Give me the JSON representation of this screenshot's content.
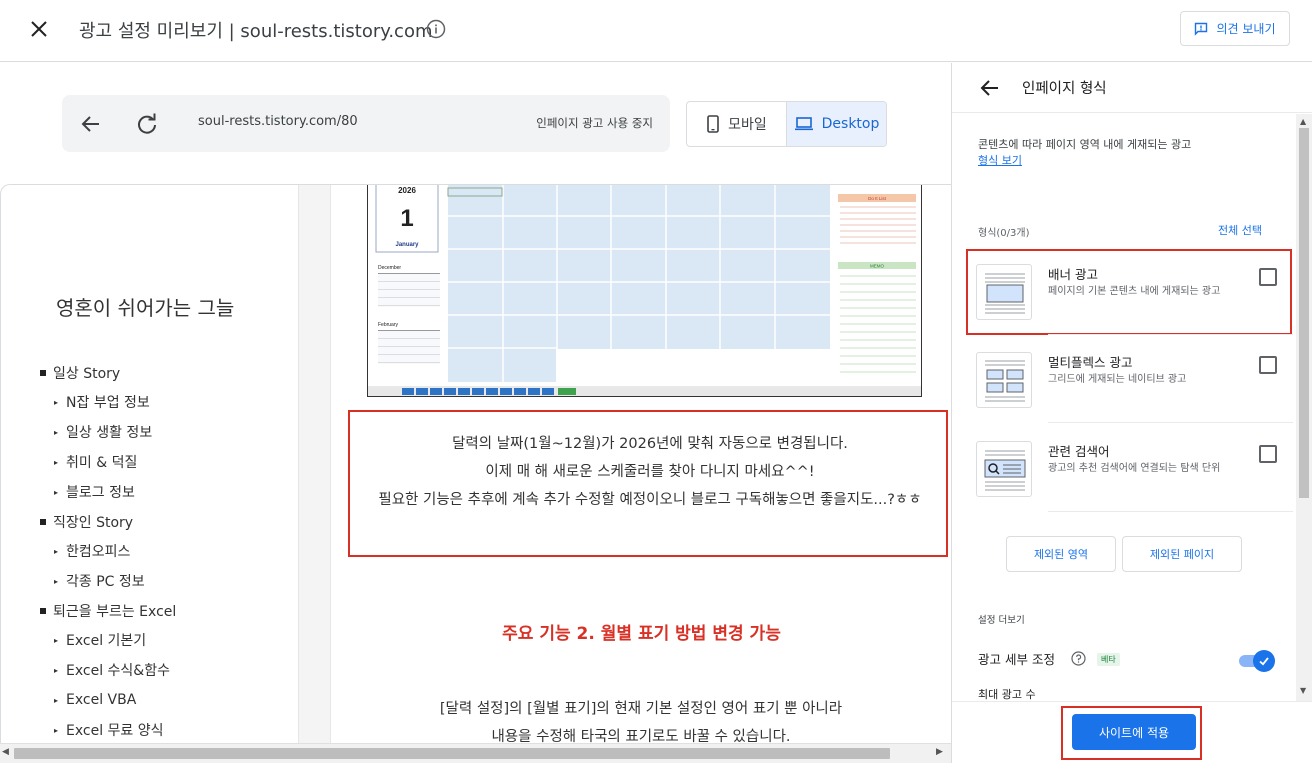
{
  "header": {
    "title": "광고 설정 미리보기 | soul-rests.tistory.com",
    "feedback_label": "의견 보내기"
  },
  "preview_bar": {
    "url": "soul-rests.tistory.com/80",
    "stop_label": "인페이지 광고 사용 중지",
    "mobile_label": "모바일",
    "desktop_label": "Desktop",
    "active_device": "Desktop"
  },
  "blog": {
    "title": "영혼이 쉬어가는 그늘",
    "categories": [
      {
        "label": "일상 Story",
        "level": "main"
      },
      {
        "label": "N잡 부업 정보",
        "level": "sub"
      },
      {
        "label": "일상 생활 정보",
        "level": "sub"
      },
      {
        "label": "취미 & 덕질",
        "level": "sub"
      },
      {
        "label": "블로그 정보",
        "level": "sub"
      },
      {
        "label": "직장인 Story",
        "level": "main"
      },
      {
        "label": "한컴오피스",
        "level": "sub"
      },
      {
        "label": "각종 PC 정보",
        "level": "sub"
      },
      {
        "label": "퇴근을 부르는 Excel",
        "level": "main"
      },
      {
        "label": "Excel 기본기",
        "level": "sub"
      },
      {
        "label": "Excel 수식&함수",
        "level": "sub"
      },
      {
        "label": "Excel VBA",
        "level": "sub"
      },
      {
        "label": "Excel 무료 양식",
        "level": "sub"
      }
    ]
  },
  "calendar_image": {
    "year": "2026",
    "day": "1",
    "month": "January",
    "mini_month_1": "December",
    "mini_month_2": "February",
    "todo_label": "Do It List",
    "memo_label": "MEMO"
  },
  "post": {
    "notice_lines": [
      "달력의 날짜(1월~12월)가 2026년에 맞춰 자동으로 변경됩니다.",
      "이제 매 해 새로운 스케줄러를 찾아 다니지 마세요^^!",
      "필요한 기능은 추후에 계속 추가 수정할 예정이오니 블로그 구독해놓으면 좋을지도...?ㅎㅎ"
    ],
    "feature_heading": "주요 기능 2. 월별 표기 방법 변경 가능",
    "body_lines": [
      "[달력 설정]의 [월별 표기]의 현재 기본 설정인 영어 표기 뿐 아니라",
      "내용을 수정해  타국의 표기로도 바꿀 수 있습니다."
    ]
  },
  "panel": {
    "title": "인페이지 형식",
    "description": "콘텐츠에 따라 페이지 영역 내에 게재되는 광고",
    "format_link": "형식 보기",
    "format_count_label": "형식(0/3개)",
    "select_all": "전체 선택",
    "formats": [
      {
        "name": "배너 광고",
        "desc": "페이지의 기본 콘텐츠 내에 게재되는 광고",
        "checked": false,
        "icon": "banner-ad-icon"
      },
      {
        "name": "멀티플렉스 광고",
        "desc": "그리드에 게재되는 네이티브 광고",
        "checked": false,
        "icon": "multiplex-ad-icon"
      },
      {
        "name": "관련 검색어",
        "desc": "광고의 추천 검색어에 연결되는 탐색 단위",
        "checked": false,
        "icon": "related-search-icon"
      }
    ],
    "excluded_areas": "제외된 영역",
    "excluded_pages": "제외된 페이지",
    "more_settings": "설정 더보기",
    "detail_tuning": "광고 세부 조정",
    "beta": "베타",
    "detail_tuning_enabled": true,
    "max_ads": "최대 광고 수",
    "apply_button": "사이트에 적용"
  },
  "colors": {
    "accent": "#1a73e8",
    "highlight_red": "#d93025",
    "active_device_bg": "#e8f0fe"
  }
}
